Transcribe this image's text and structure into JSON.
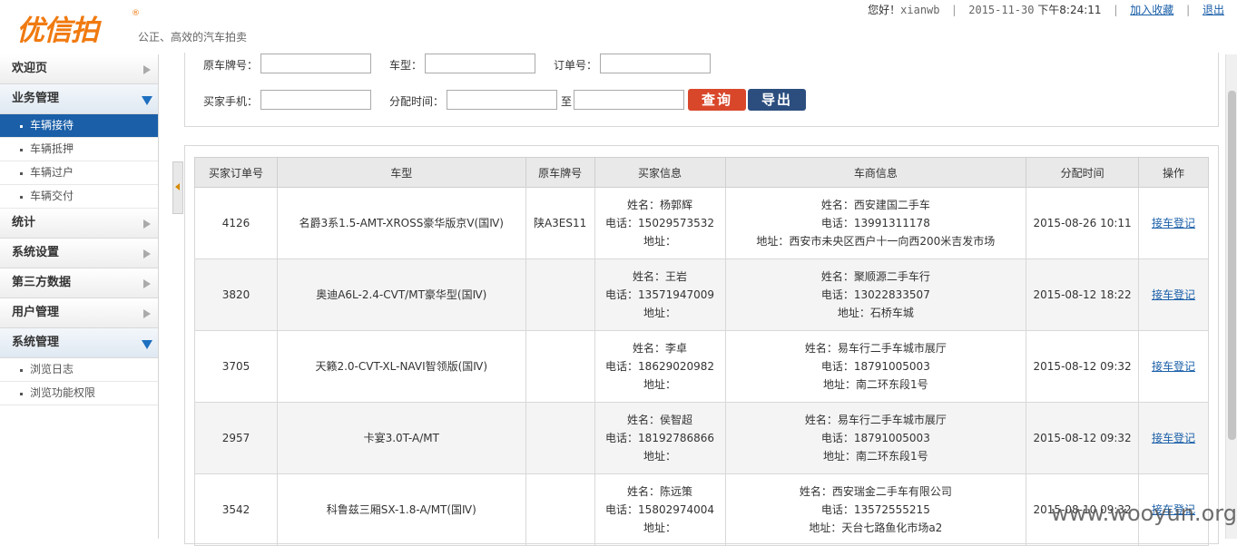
{
  "header": {
    "logo": "优信拍",
    "logo_mark": "®",
    "slogan": "公正、高效的汽车拍卖",
    "greeting": "您好！",
    "username": "xianwb",
    "date": "2015-11-30",
    "time": "下午8:24:11",
    "bookmark": "加入收藏",
    "logout": "退出"
  },
  "sidebar": {
    "sections": [
      {
        "label": "欢迎页",
        "open": false,
        "items": []
      },
      {
        "label": "业务管理",
        "open": true,
        "items": [
          "车辆接待",
          "车辆抵押",
          "车辆过户",
          "车辆交付"
        ]
      },
      {
        "label": "统计",
        "open": false,
        "items": []
      },
      {
        "label": "系统设置",
        "open": false,
        "items": []
      },
      {
        "label": "第三方数据",
        "open": false,
        "items": []
      },
      {
        "label": "用户管理",
        "open": false,
        "items": []
      },
      {
        "label": "系统管理",
        "open": true,
        "items": [
          "浏览日志",
          "浏览功能权限"
        ]
      }
    ],
    "active_item": "车辆接待"
  },
  "search": {
    "plate_label": "原车牌号：",
    "model_label": "车型：",
    "order_label": "订单号：",
    "phone_label": "买家手机：",
    "date_label": "分配时间：",
    "to_label": "至",
    "query_button": "查询",
    "export_button": "导出"
  },
  "table": {
    "headers": [
      "买家订单号",
      "车型",
      "原车牌号",
      "买家信息",
      "车商信息",
      "分配时间",
      "操作"
    ],
    "rows": [
      {
        "order": "4126",
        "model": "名爵3系1.5-AMT-XROSS豪华版京Ⅴ(国Ⅳ)",
        "plate": "陕A3ES11",
        "buyer_name": "姓名：杨郭辉",
        "buyer_phone": "电话：15029573532",
        "buyer_addr": "地址：",
        "dealer_name": "姓名：西安建国二手车",
        "dealer_phone": "电话：13991311178",
        "dealer_addr": "地址：西安市未央区西户十一向西200米吉发市场",
        "time": "2015-08-26 10:11",
        "action": "接车登记"
      },
      {
        "order": "3820",
        "model": "奥迪A6L-2.4-CVT/MT豪华型(国Ⅳ)",
        "plate": "",
        "buyer_name": "姓名：王岩",
        "buyer_phone": "电话：13571947009",
        "buyer_addr": "地址：",
        "dealer_name": "姓名：聚顺源二手车行",
        "dealer_phone": "电话：13022833507",
        "dealer_addr": "地址：石桥车城",
        "time": "2015-08-12 18:22",
        "action": "接车登记"
      },
      {
        "order": "3705",
        "model": "天籁2.0-CVT-XL-NAVI智领版(国Ⅳ)",
        "plate": "",
        "buyer_name": "姓名：李卓",
        "buyer_phone": "电话：18629020982",
        "buyer_addr": "地址：",
        "dealer_name": "姓名：易车行二手车城市展厅",
        "dealer_phone": "电话：18791005003",
        "dealer_addr": "地址：南二环东段1号",
        "time": "2015-08-12 09:32",
        "action": "接车登记"
      },
      {
        "order": "2957",
        "model": "卡宴3.0T-A/MT",
        "plate": "",
        "buyer_name": "姓名：侯智超",
        "buyer_phone": "电话：18192786866",
        "buyer_addr": "地址：",
        "dealer_name": "姓名：易车行二手车城市展厅",
        "dealer_phone": "电话：18791005003",
        "dealer_addr": "地址：南二环东段1号",
        "time": "2015-08-12 09:32",
        "action": "接车登记"
      },
      {
        "order": "3542",
        "model": "科鲁兹三厢SX-1.8-A/MT(国Ⅳ)",
        "plate": "",
        "buyer_name": "姓名：陈远策",
        "buyer_phone": "电话：15802974004",
        "buyer_addr": "地址：",
        "dealer_name": "姓名：西安瑞金二手车有限公司",
        "dealer_phone": "电话：13572555215",
        "dealer_addr": "地址：天台七路鱼化市场a2",
        "time": "2015-08-10 09:32",
        "action": "接车登记"
      }
    ]
  },
  "watermark": "www.wooyun.org",
  "colors": {
    "brand_orange": "#f07a10",
    "active_blue": "#1a5fa8",
    "query_red": "#d9472b",
    "export_navy": "#2c4e7f"
  }
}
